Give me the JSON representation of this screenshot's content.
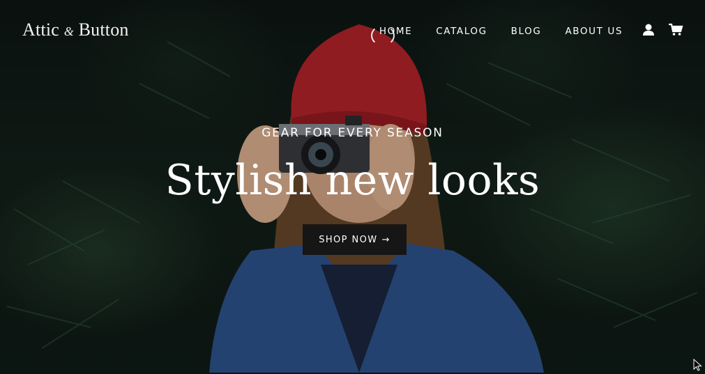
{
  "header": {
    "logo_main": "Attic",
    "logo_amp": "&",
    "logo_end": "Button",
    "nav": [
      {
        "label": "HOME"
      },
      {
        "label": "CATALOG"
      },
      {
        "label": "BLOG"
      },
      {
        "label": "ABOUT US"
      }
    ],
    "icons": {
      "account": "account-icon",
      "cart": "cart-icon"
    }
  },
  "hero": {
    "kicker": "GEAR FOR EVERY SEASON",
    "headline": "Stylish new looks",
    "cta_label": "SHOP NOW",
    "cta_arrow": "→"
  },
  "colors": {
    "button_bg": "#161616",
    "text": "#ffffff",
    "hat": "#b8242a",
    "jacket": "#2f5590"
  }
}
